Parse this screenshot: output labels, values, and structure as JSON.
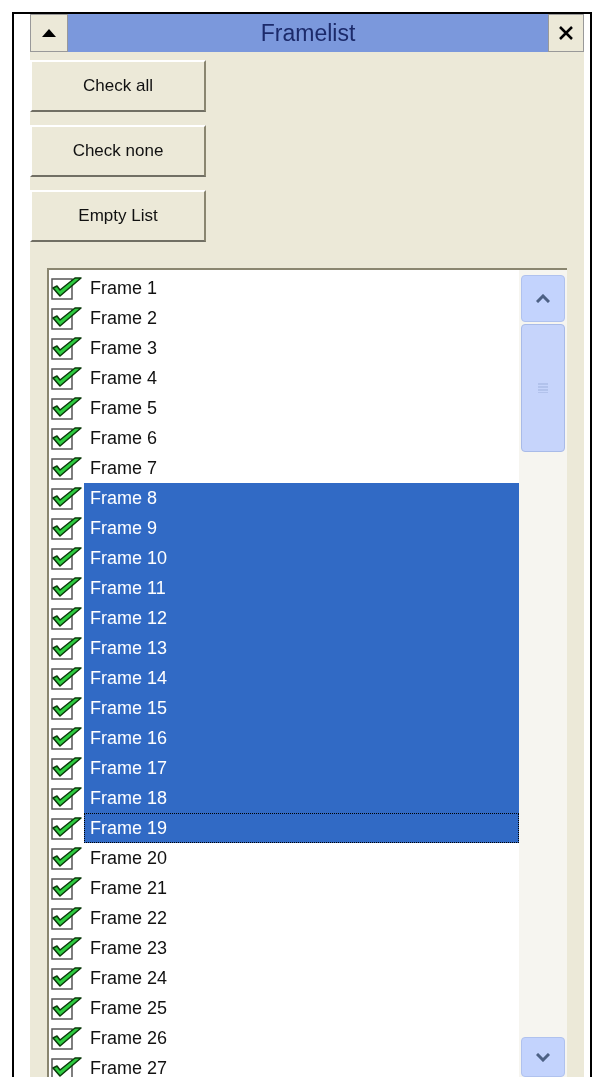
{
  "window": {
    "title": "Framelist"
  },
  "buttons": [
    "Check all",
    "Check none",
    "Empty List"
  ],
  "frames": [
    {
      "label": "Frame 1",
      "checked": true,
      "selected": false,
      "focused": false
    },
    {
      "label": "Frame 2",
      "checked": true,
      "selected": false,
      "focused": false
    },
    {
      "label": "Frame 3",
      "checked": true,
      "selected": false,
      "focused": false
    },
    {
      "label": "Frame 4",
      "checked": true,
      "selected": false,
      "focused": false
    },
    {
      "label": "Frame 5",
      "checked": true,
      "selected": false,
      "focused": false
    },
    {
      "label": "Frame 6",
      "checked": true,
      "selected": false,
      "focused": false
    },
    {
      "label": "Frame 7",
      "checked": true,
      "selected": false,
      "focused": false
    },
    {
      "label": "Frame 8",
      "checked": true,
      "selected": true,
      "focused": false
    },
    {
      "label": "Frame 9",
      "checked": true,
      "selected": true,
      "focused": false
    },
    {
      "label": "Frame 10",
      "checked": true,
      "selected": true,
      "focused": false
    },
    {
      "label": "Frame 11",
      "checked": true,
      "selected": true,
      "focused": false
    },
    {
      "label": "Frame 12",
      "checked": true,
      "selected": true,
      "focused": false
    },
    {
      "label": "Frame 13",
      "checked": true,
      "selected": true,
      "focused": false
    },
    {
      "label": "Frame 14",
      "checked": true,
      "selected": true,
      "focused": false
    },
    {
      "label": "Frame 15",
      "checked": true,
      "selected": true,
      "focused": false
    },
    {
      "label": "Frame 16",
      "checked": true,
      "selected": true,
      "focused": false
    },
    {
      "label": "Frame 17",
      "checked": true,
      "selected": true,
      "focused": false
    },
    {
      "label": "Frame 18",
      "checked": true,
      "selected": true,
      "focused": false
    },
    {
      "label": "Frame 19",
      "checked": true,
      "selected": true,
      "focused": true
    },
    {
      "label": "Frame 20",
      "checked": true,
      "selected": false,
      "focused": false
    },
    {
      "label": "Frame 21",
      "checked": true,
      "selected": false,
      "focused": false
    },
    {
      "label": "Frame 22",
      "checked": true,
      "selected": false,
      "focused": false
    },
    {
      "label": "Frame 23",
      "checked": true,
      "selected": false,
      "focused": false
    },
    {
      "label": "Frame 24",
      "checked": true,
      "selected": false,
      "focused": false
    },
    {
      "label": "Frame 25",
      "checked": true,
      "selected": false,
      "focused": false
    },
    {
      "label": "Frame 26",
      "checked": true,
      "selected": false,
      "focused": false
    },
    {
      "label": "Frame 27",
      "checked": true,
      "selected": false,
      "focused": false
    }
  ]
}
